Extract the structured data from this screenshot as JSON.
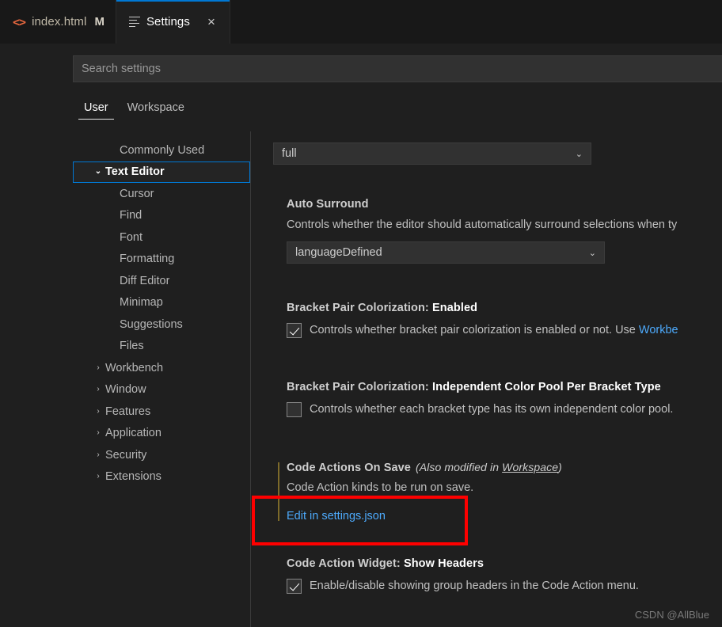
{
  "window": {
    "background_color": "#1f1f1f"
  },
  "tabs": [
    {
      "label": "index.html",
      "dirty_indicator": "M",
      "icon": "html-file-icon",
      "active": false
    },
    {
      "label": "Settings",
      "icon": "settings-list-icon",
      "close_icon": "×",
      "active": true
    }
  ],
  "search": {
    "placeholder": "Search settings",
    "value": ""
  },
  "scope_tabs": [
    {
      "label": "User",
      "active": true
    },
    {
      "label": "Workspace",
      "active": false
    }
  ],
  "toc": [
    {
      "label": "Commonly Used",
      "level": 1,
      "chevron": "",
      "selected": false
    },
    {
      "label": "Text Editor",
      "level": 0,
      "chevron": "⌄",
      "selected": true
    },
    {
      "label": "Cursor",
      "level": 1,
      "chevron": "",
      "selected": false
    },
    {
      "label": "Find",
      "level": 1,
      "chevron": "",
      "selected": false
    },
    {
      "label": "Font",
      "level": 1,
      "chevron": "",
      "selected": false
    },
    {
      "label": "Formatting",
      "level": 1,
      "chevron": "",
      "selected": false
    },
    {
      "label": "Diff Editor",
      "level": 1,
      "chevron": "",
      "selected": false
    },
    {
      "label": "Minimap",
      "level": 1,
      "chevron": "",
      "selected": false
    },
    {
      "label": "Suggestions",
      "level": 1,
      "chevron": "",
      "selected": false
    },
    {
      "label": "Files",
      "level": 1,
      "chevron": "",
      "selected": false
    },
    {
      "label": "Workbench",
      "level": 0,
      "chevron": "›",
      "selected": false
    },
    {
      "label": "Window",
      "level": 0,
      "chevron": "›",
      "selected": false
    },
    {
      "label": "Features",
      "level": 0,
      "chevron": "›",
      "selected": false
    },
    {
      "label": "Application",
      "level": 0,
      "chevron": "›",
      "selected": false
    },
    {
      "label": "Security",
      "level": 0,
      "chevron": "›",
      "selected": false
    },
    {
      "label": "Extensions",
      "level": 0,
      "chevron": "›",
      "selected": false
    }
  ],
  "settings": {
    "top_dropdown": {
      "value": "full",
      "chevron": "⌄"
    },
    "auto_surround": {
      "title": "Auto Surround",
      "description": "Controls whether the editor should automatically surround selections when ty",
      "dropdown_value": "languageDefined",
      "chevron": "⌄"
    },
    "bracket_enabled": {
      "title_prefix": "Bracket Pair Colorization: ",
      "title_emph": "Enabled",
      "description": "Controls whether bracket pair colorization is enabled or not. Use ",
      "description_link": "Workbe",
      "checked": true
    },
    "bracket_independent": {
      "title_prefix": "Bracket Pair Colorization: ",
      "title_emph": "Independent Color Pool Per Bracket Type",
      "description": "Controls whether each bracket type has its own independent color pool.",
      "checked": false
    },
    "code_actions_on_save": {
      "title": "Code Actions On Save",
      "scope_note_prefix": "(Also modified in ",
      "scope_note_link": "Workspace",
      "scope_note_suffix": ")",
      "description": "Code Action kinds to be run on save.",
      "edit_link": "Edit in settings.json",
      "modified": true
    },
    "code_action_widget": {
      "title_prefix": "Code Action Widget: ",
      "title_emph": "Show Headers",
      "description": "Enable/disable showing group headers in the Code Action menu.",
      "checked": true
    }
  },
  "annotation": {
    "color": "#fe0000"
  },
  "watermark": {
    "text": "CSDN @AllBlue"
  }
}
